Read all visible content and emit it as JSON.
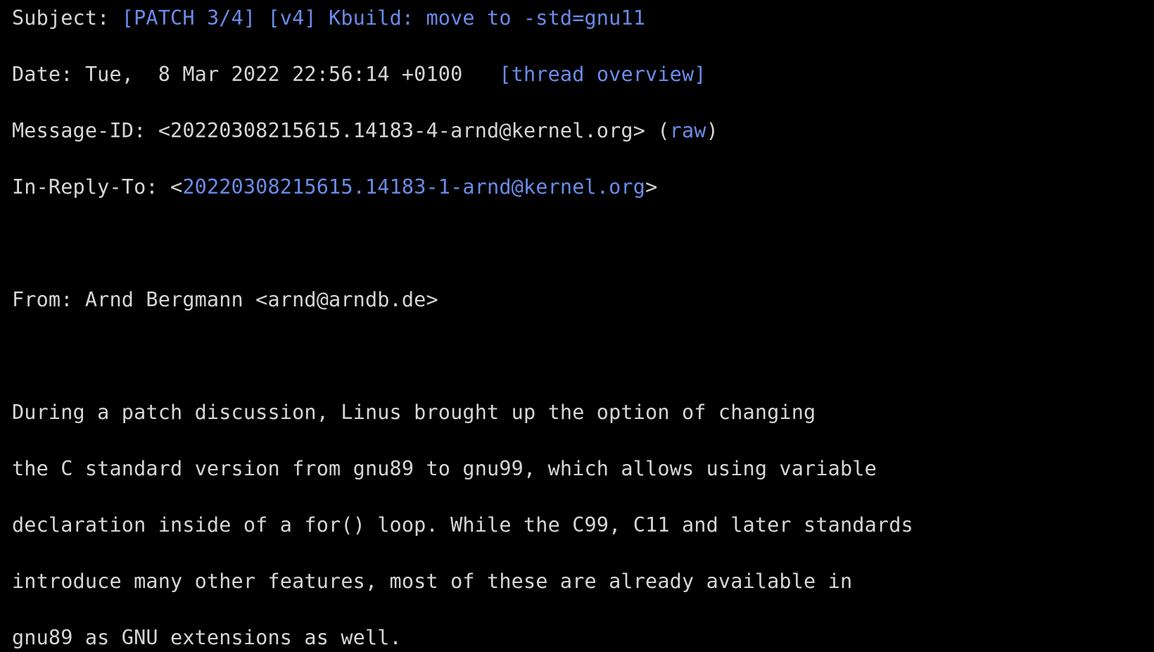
{
  "page": {
    "background_color": "#000000",
    "text_color": "#d6d6d6",
    "link_color": "#6a8ce8",
    "font": "monospace"
  },
  "headers": {
    "subject": {
      "label": "Subject: ",
      "link_text": "[PATCH 3/4] [v4] Kbuild: move to -std=gnu11"
    },
    "date": {
      "label": "Date: ",
      "value": "Tue,  8 Mar 2022 22:56:14 +0100",
      "separator": "   ",
      "thread_overview_link": "[thread overview]"
    },
    "message_id": {
      "label": "Message-ID: ",
      "value": "<20220308215615.14183-4-arnd@kernel.org>",
      "space": " ",
      "raw_open_paren": "(",
      "raw_link": "raw",
      "raw_close_paren": ")"
    },
    "in_reply_to": {
      "label": "In-Reply-To: ",
      "open_bracket": "<",
      "link_text": "20220308215615.14183-1-arnd@kernel.org",
      "close_bracket": ">"
    }
  },
  "from": {
    "line": "From: Arnd Bergmann <arnd@arndb.de>"
  },
  "body": {
    "lines": [
      "During a patch discussion, Linus brought up the option of changing",
      "the C standard version from gnu89 to gnu99, which allows using variable",
      "declaration inside of a for() loop. While the C99, C11 and later standards",
      "introduce many other features, most of these are already available in",
      "gnu89 as GNU extensions as well."
    ]
  }
}
